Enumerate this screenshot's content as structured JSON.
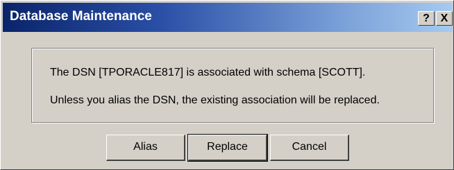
{
  "window": {
    "title": "Database Maintenance",
    "help_label": "?",
    "close_label": "X"
  },
  "message": {
    "line1": "The DSN [TPORACLE817] is associated with schema [SCOTT].",
    "line2": "Unless you alias the DSN, the existing association will be replaced."
  },
  "buttons": {
    "alias": "Alias",
    "replace": "Replace",
    "cancel": "Cancel"
  }
}
